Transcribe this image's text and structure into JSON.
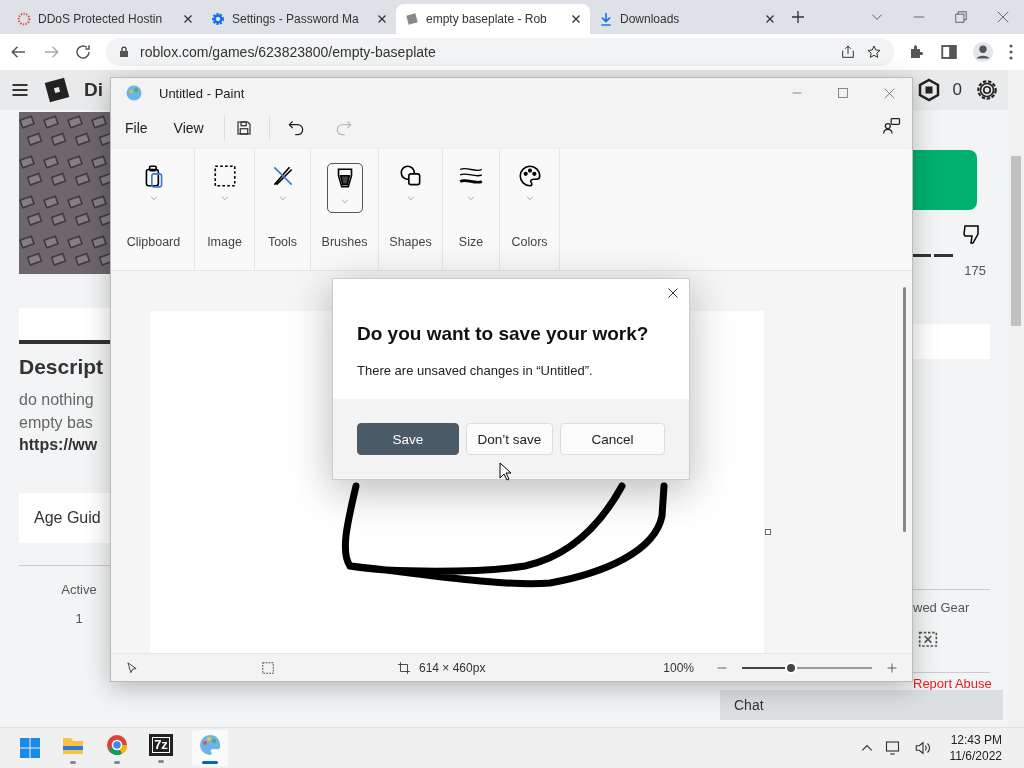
{
  "browser": {
    "tabs": [
      {
        "kind": "ddos",
        "title": "DDoS Protected Hostin",
        "selected": false
      },
      {
        "kind": "gear",
        "title": "Settings - Password Ma",
        "selected": false
      },
      {
        "kind": "roblox",
        "title": "empty baseplate - Rob",
        "selected": true
      },
      {
        "kind": "download",
        "title": "Downloads",
        "selected": false
      }
    ],
    "url": "roblox.com/games/623823800/empty-baseplate"
  },
  "page": {
    "header_title": "Di",
    "robux": "0",
    "description_heading": "Descript",
    "description_lines": [
      "do nothing",
      "empty bas",
      "https://ww"
    ],
    "age_guidance": "Age Guid",
    "stat_label": "Active",
    "stat_value": "1",
    "dislikes": "175",
    "gear_label": "wed Gear",
    "report_link": "Report Abuse",
    "chat": "Chat"
  },
  "paint": {
    "title": "Untitled - Paint",
    "menu": [
      "File",
      "View"
    ],
    "ribbon": [
      {
        "kind": "clipboard",
        "label": "Clipboard",
        "selected": false
      },
      {
        "label": "Image",
        "selected": false
      },
      {
        "kind": "tools",
        "label": "Tools",
        "selected": false
      },
      {
        "kind": "brushes",
        "label": "Brushes",
        "selected": true
      },
      {
        "kind": "shapes",
        "label": "Shapes",
        "selected": false
      },
      {
        "kind": "size",
        "label": "Size",
        "selected": false
      },
      {
        "kind": "colors",
        "label": "Colors",
        "selected": false
      }
    ],
    "canvas_size": "614 × 460px",
    "zoom": "100%",
    "zoom_slider": {
      "level": 0.38
    }
  },
  "dialog": {
    "title": "Do you want to save your work?",
    "message": "There are unsaved changes in “Untitled”.",
    "buttons": [
      {
        "label": "Save",
        "selected": true
      },
      {
        "label": "Don’t save",
        "selected": false
      },
      {
        "label": "Cancel",
        "selected": false
      }
    ]
  },
  "taskbar": {
    "apps": [
      {
        "kind": "folder",
        "active": false
      },
      {
        "kind": "chrome",
        "active": false
      },
      {
        "kind": "archive",
        "label": "7z",
        "active": false
      },
      {
        "kind": "paint",
        "active": true
      }
    ],
    "time": "12:43 PM",
    "date": "11/6/2022"
  }
}
